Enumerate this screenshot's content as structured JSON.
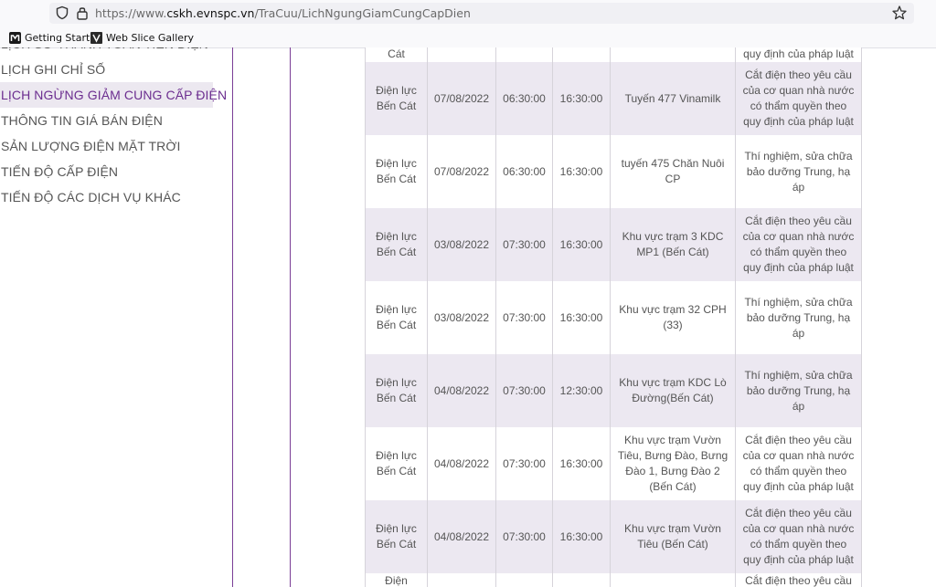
{
  "browser": {
    "url_prefix": "https://www.",
    "url_host": "cskh.evnspc.vn",
    "url_path": "/TraCuu/LichNgungGiamCungCapDien",
    "bookmarks": [
      {
        "label": "Getting Started",
        "icon": "firefox-bookmark-icon"
      },
      {
        "label": "Web Slice Gallery",
        "icon": "web-slice-icon"
      }
    ]
  },
  "sidebar": {
    "items": [
      {
        "label": "LỊCH SỬ THANH TOÁN TIỀN ĐIỆN",
        "active": false
      },
      {
        "label": "LỊCH GHI CHỈ SỐ",
        "active": false
      },
      {
        "label": "LỊCH NGỪNG GIẢM CUNG CẤP ĐIỆN",
        "active": true
      },
      {
        "label": "THÔNG TIN GIÁ BÁN ĐIỆN",
        "active": false
      },
      {
        "label": "SẢN LƯỢNG ĐIỆN MẶT TRỜI",
        "active": false
      },
      {
        "label": "TIẾN ĐỘ CẤP ĐIỆN",
        "active": false
      },
      {
        "label": "TIẾN ĐỘ CÁC DỊCH VỤ KHÁC",
        "active": false
      }
    ]
  },
  "table": {
    "top_stub": {
      "unit": "Cát",
      "reason": "quy định của pháp luật"
    },
    "rows": [
      {
        "unit": "Điện lực Bến Cát",
        "date": "07/08/2022",
        "start": "06:30:00",
        "end": "16:30:00",
        "area": "Tuyến 477 Vinamilk",
        "reason": "Cắt điện theo yêu cầu của cơ quan nhà nước có thẩm quyền theo quy định của pháp luật"
      },
      {
        "unit": "Điện lực Bến Cát",
        "date": "07/08/2022",
        "start": "06:30:00",
        "end": "16:30:00",
        "area": "tuyến 475 Chăn Nuôi CP",
        "reason": "Thí nghiệm, sửa chữa bảo dưỡng Trung, hạ áp"
      },
      {
        "unit": "Điện lực Bến Cát",
        "date": "03/08/2022",
        "start": "07:30:00",
        "end": "16:30:00",
        "area": "Khu vực trạm 3 KDC MP1 (Bến Cát)",
        "reason": "Cắt điện theo yêu cầu của cơ quan nhà nước có thẩm quyền theo quy định của pháp luật"
      },
      {
        "unit": "Điện lực Bến Cát",
        "date": "03/08/2022",
        "start": "07:30:00",
        "end": "16:30:00",
        "area": "Khu vực trạm 32 CPH (33)",
        "reason": "Thí nghiệm, sửa chữa bảo dưỡng Trung, hạ áp"
      },
      {
        "unit": "Điện lực Bến Cát",
        "date": "04/08/2022",
        "start": "07:30:00",
        "end": "12:30:00",
        "area": "Khu vực trạm KDC Lò Đường(Bến Cát)",
        "reason": "Thí nghiệm, sửa chữa bảo dưỡng Trung, hạ áp"
      },
      {
        "unit": "Điện lực Bến Cát",
        "date": "04/08/2022",
        "start": "07:30:00",
        "end": "16:30:00",
        "area": "Khu vực trạm Vườn Tiêu, Bưng Đào, Bưng Đào 1, Bưng Đào 2 (Bến Cát)",
        "reason": "Cắt điện theo yêu cầu của cơ quan nhà nước có thẩm quyền theo quy định của pháp luật"
      },
      {
        "unit": "Điện lực Bến Cát",
        "date": "04/08/2022",
        "start": "07:30:00",
        "end": "16:30:00",
        "area": "Khu vực trạm Vườn Tiêu (Bến Cát)",
        "reason": "Cắt điện theo yêu cầu của cơ quan nhà nước có thẩm quyền theo quy định của pháp luật"
      }
    ],
    "bottom_stub": {
      "unit": "Điện",
      "reason": "Cắt điện theo yêu cầu"
    }
  },
  "colors": {
    "accent": "#6b2d8f",
    "row_alt": "#ece8f1",
    "divider": "#7a3e96"
  }
}
